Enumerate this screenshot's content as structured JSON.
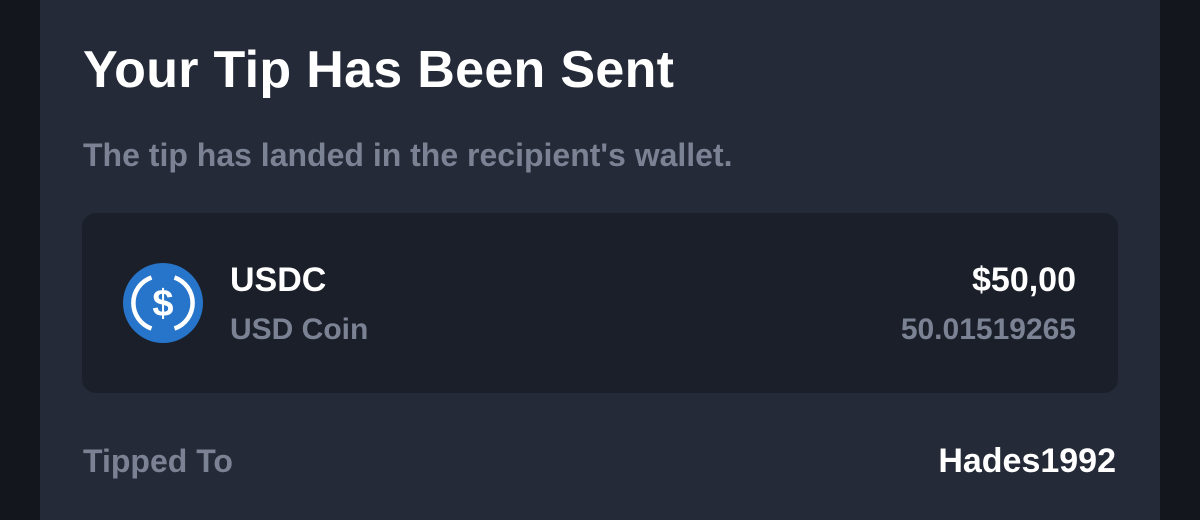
{
  "modal": {
    "title": "Your Tip Has Been Sent",
    "subtitle": "The tip has landed in the recipient's wallet."
  },
  "asset": {
    "icon": "usdc-coin-icon",
    "symbol": "USDC",
    "name": "USD Coin",
    "fiat_amount": "$50,00",
    "crypto_amount": "50.01519265"
  },
  "details": {
    "tipped_to_label": "Tipped To",
    "tipped_to_value": "Hades1992"
  },
  "colors": {
    "page_background": "#13161d",
    "modal_background": "#242a37",
    "card_background": "#1b1f29",
    "primary_text": "#ffffff",
    "secondary_text": "#7b8293",
    "usdc_blue": "#2775ca"
  }
}
